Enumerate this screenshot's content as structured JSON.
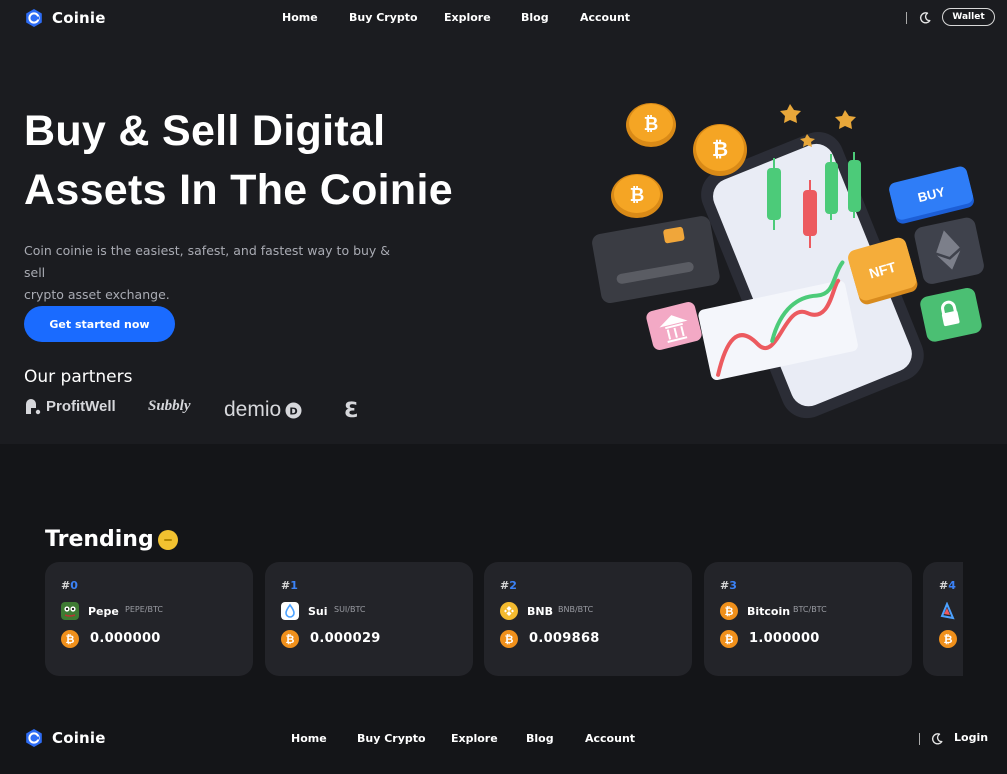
{
  "brand": {
    "name": "Coinie"
  },
  "header": {
    "nav": [
      "Home",
      "Buy Crypto",
      "Explore",
      "Blog",
      "Account"
    ],
    "wallet_label": "Wallet",
    "theme_icon": "moon-icon"
  },
  "hero": {
    "title_line1": "Buy & Sell Digital",
    "title_line2": "Assets In The Coinie",
    "description_line1": "Coin coinie is the easiest, safest, and fastest way to buy & sell",
    "description_line2": "crypto asset exchange.",
    "cta_label": "Get started now",
    "partners_title": "Our partners",
    "partners": [
      "ProfitWell",
      "Subbly",
      "demio",
      "ℇ"
    ]
  },
  "trending": {
    "title": "Trending",
    "cards": [
      {
        "hash": "#",
        "rank": "0",
        "name": "Pepe",
        "pair": "PEPE/BTC",
        "price": "0.000000",
        "icon": "pepe-icon"
      },
      {
        "hash": "#",
        "rank": "1",
        "name": "Sui",
        "pair": "SUI/BTC",
        "price": "0.000029",
        "icon": "sui-icon"
      },
      {
        "hash": "#",
        "rank": "2",
        "name": "BNB",
        "pair": "BNB/BTC",
        "price": "0.009868",
        "icon": "bnb-icon"
      },
      {
        "hash": "#",
        "rank": "3",
        "name": "Bitcoin",
        "pair": "BTC/BTC",
        "price": "1.000000",
        "icon": "bitcoin-icon"
      },
      {
        "hash": "#",
        "rank": "4",
        "name": "",
        "pair": "",
        "price": "",
        "icon": "coin-icon"
      }
    ]
  },
  "footer": {
    "brand": "Coinie",
    "nav": [
      "Home",
      "Buy Crypto",
      "Explore",
      "Blog",
      "Account"
    ],
    "login_label": "Login"
  },
  "colors": {
    "accent": "#1a6bff",
    "background": "#141518",
    "surface": "#1b1c20",
    "card": "#232429",
    "btc_orange": "#f0901b"
  }
}
